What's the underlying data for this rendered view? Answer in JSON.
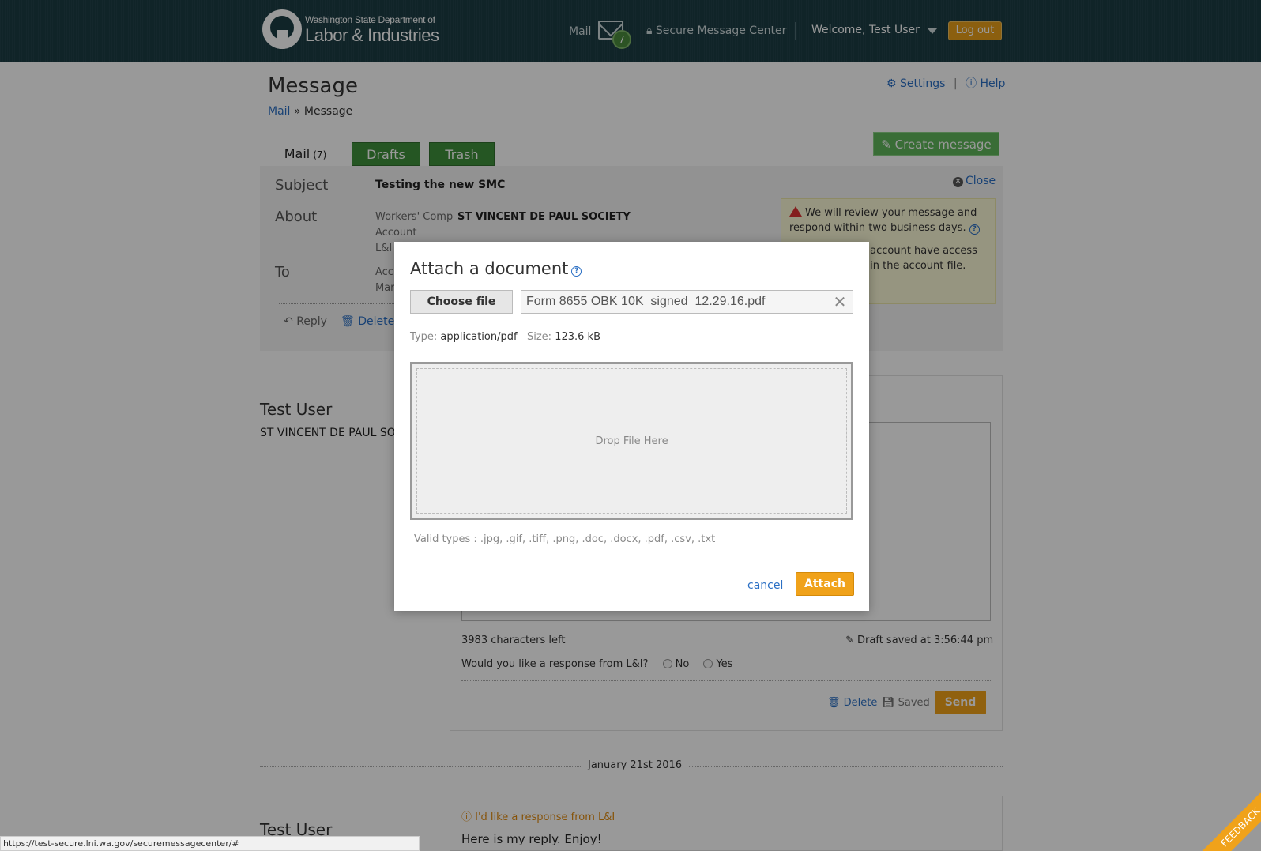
{
  "header": {
    "logo_line1": "Washington State Department of",
    "logo_line2": "Labor & Industries",
    "mail_label": "Mail",
    "mail_count": "7",
    "secure_center": "Secure Message Center",
    "welcome": "Welcome, Test User",
    "logout": "Log out",
    "icons": [
      "envelope-icon",
      "lock-icon",
      "caret-down-icon"
    ]
  },
  "page": {
    "title": "Message",
    "breadcrumb_link": "Mail",
    "breadcrumb_sep": "»",
    "breadcrumb_current": "Message",
    "settings": "Settings",
    "help": "Help",
    "create_message": "Create message"
  },
  "tabs": [
    {
      "label": "Mail",
      "count": "(7)"
    },
    {
      "label": "Drafts"
    },
    {
      "label": "Trash"
    }
  ],
  "message": {
    "subject_label": "Subject",
    "subject": "Testing the new SMC",
    "about_label": "About",
    "about_line1": "Workers' Comp",
    "about_line2": "Account",
    "about_line3": "L&I",
    "about_org": "ST VINCENT DE PAUL SOCIETY",
    "to_label": "To",
    "to_line1": "Acc",
    "to_line2": "Mar",
    "close": "Close",
    "reply": "Reply",
    "delete": "Delete"
  },
  "notice": {
    "line1": "We will review your message and respond within two business days.",
    "line2a": "e account have access",
    "line2b": "e in the account file."
  },
  "thread": {
    "sender": "Test User",
    "sender_org": "ST VINCENT DE PAUL SOC",
    "chars_left": "3983 characters left",
    "draft_saved": "Draft saved at 3:56:44 pm",
    "response_question": "Would you like a response from L&I?",
    "response_no": "No",
    "response_yes": "Yes",
    "delete": "Delete",
    "saved": "Saved",
    "send": "Send",
    "date": "January 21st 2016",
    "reply_flag": "I'd like a response from L&I",
    "reply_text": "Here is my reply. Enjoy!",
    "sender2": "Test User"
  },
  "modal": {
    "title": "Attach a document",
    "choose_file": "Choose file",
    "file_name": "Form 8655 OBK 10K_signed_12.29.16.pdf",
    "type_label": "Type:",
    "type_value": "application/pdf",
    "size_label": "Size:",
    "size_value": "123.6 kB",
    "drop_text": "Drop File Here",
    "valid_types": "Valid types : .jpg, .gif, .tiff, .png, .doc, .docx, .pdf, .csv, .txt",
    "cancel": "cancel",
    "attach": "Attach"
  },
  "status_bar": {
    "url": "https://test-secure.lni.wa.gov/securemessagecenter/#"
  },
  "feedback": "FEEDBACK",
  "colors": {
    "header_bg": "#1b3c44",
    "accent_orange": "#f0a21a",
    "tab_green": "#3f8f3b",
    "link_blue": "#2a6fc4"
  }
}
